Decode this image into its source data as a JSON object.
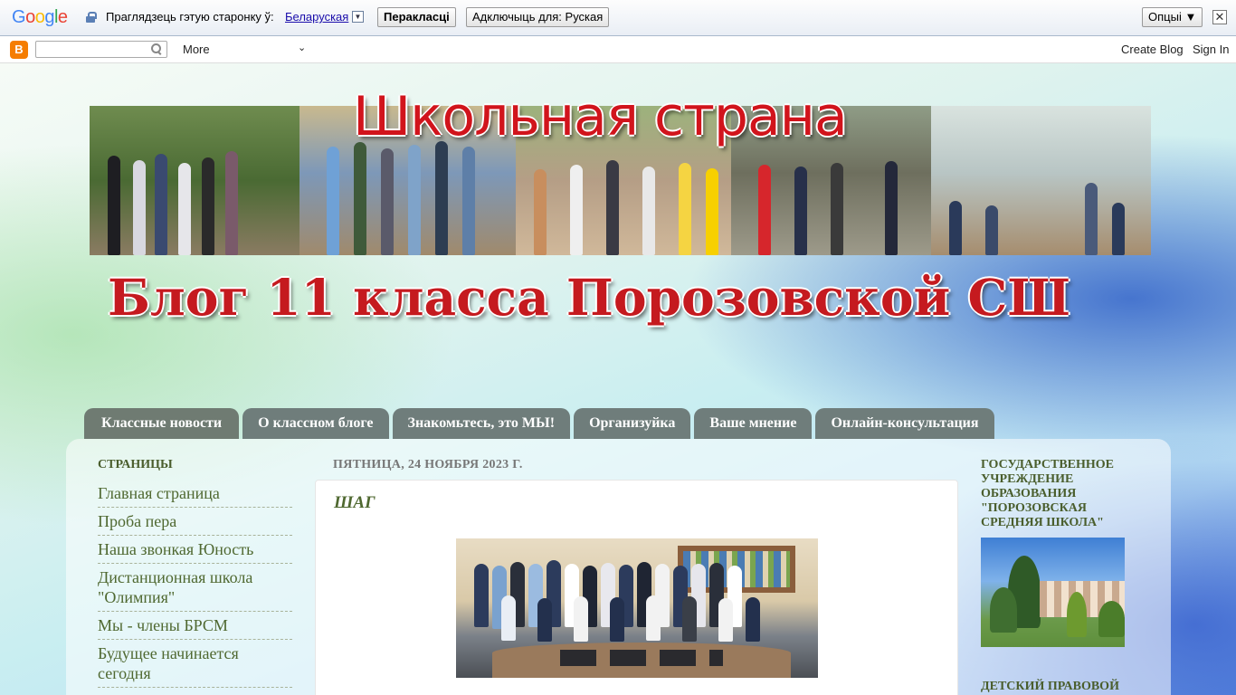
{
  "translate_bar": {
    "google_logo": [
      "G",
      "o",
      "o",
      "g",
      "l",
      "e"
    ],
    "lock_icon": "lock-icon",
    "prompt": "Праглядзець гэтую старонку ў:",
    "language": "Беларуская",
    "translate_button": "Перакласці",
    "disable_button": "Адключыць для: Руская",
    "options_button": "Опцыі ▼",
    "close": "✕"
  },
  "navbar": {
    "blogger_icon": "B",
    "more_label": "More",
    "more_arrow": "⌄",
    "create_blog": "Create Blog",
    "sign_in": "Sign In"
  },
  "header": {
    "title_top": "Школьная страна",
    "title_bottom": "Блог 11 класса Порозовской СШ"
  },
  "tabs": [
    "Классные новости",
    "О классном блоге",
    "Знакомьтесь, это МЫ!",
    "Организуйка",
    "Ваше мнение",
    "Онлайн-консультация"
  ],
  "sidebar_left": {
    "title": "СТРАНИЦЫ",
    "items": [
      "Главная страница",
      "Проба пера",
      "Наша звонкая Юность",
      "Дистанционная школа \"Олимпия\"",
      "Мы - члены БРСМ",
      "Будущее начинается сегодня"
    ]
  },
  "main": {
    "date": "ПЯТНИЦА, 24 НОЯБРЯ 2023 Г.",
    "post_title": "ШАГ"
  },
  "sidebar_right": {
    "title": "ГОСУДАРСТВЕННОЕ УЧРЕЖДЕНИЕ ОБРАЗОВАНИЯ \"ПОРОЗОВСКАЯ СРЕДНЯЯ ШКОЛА\"",
    "title2": "ДЕТСКИЙ ПРАВОВОЙ"
  }
}
